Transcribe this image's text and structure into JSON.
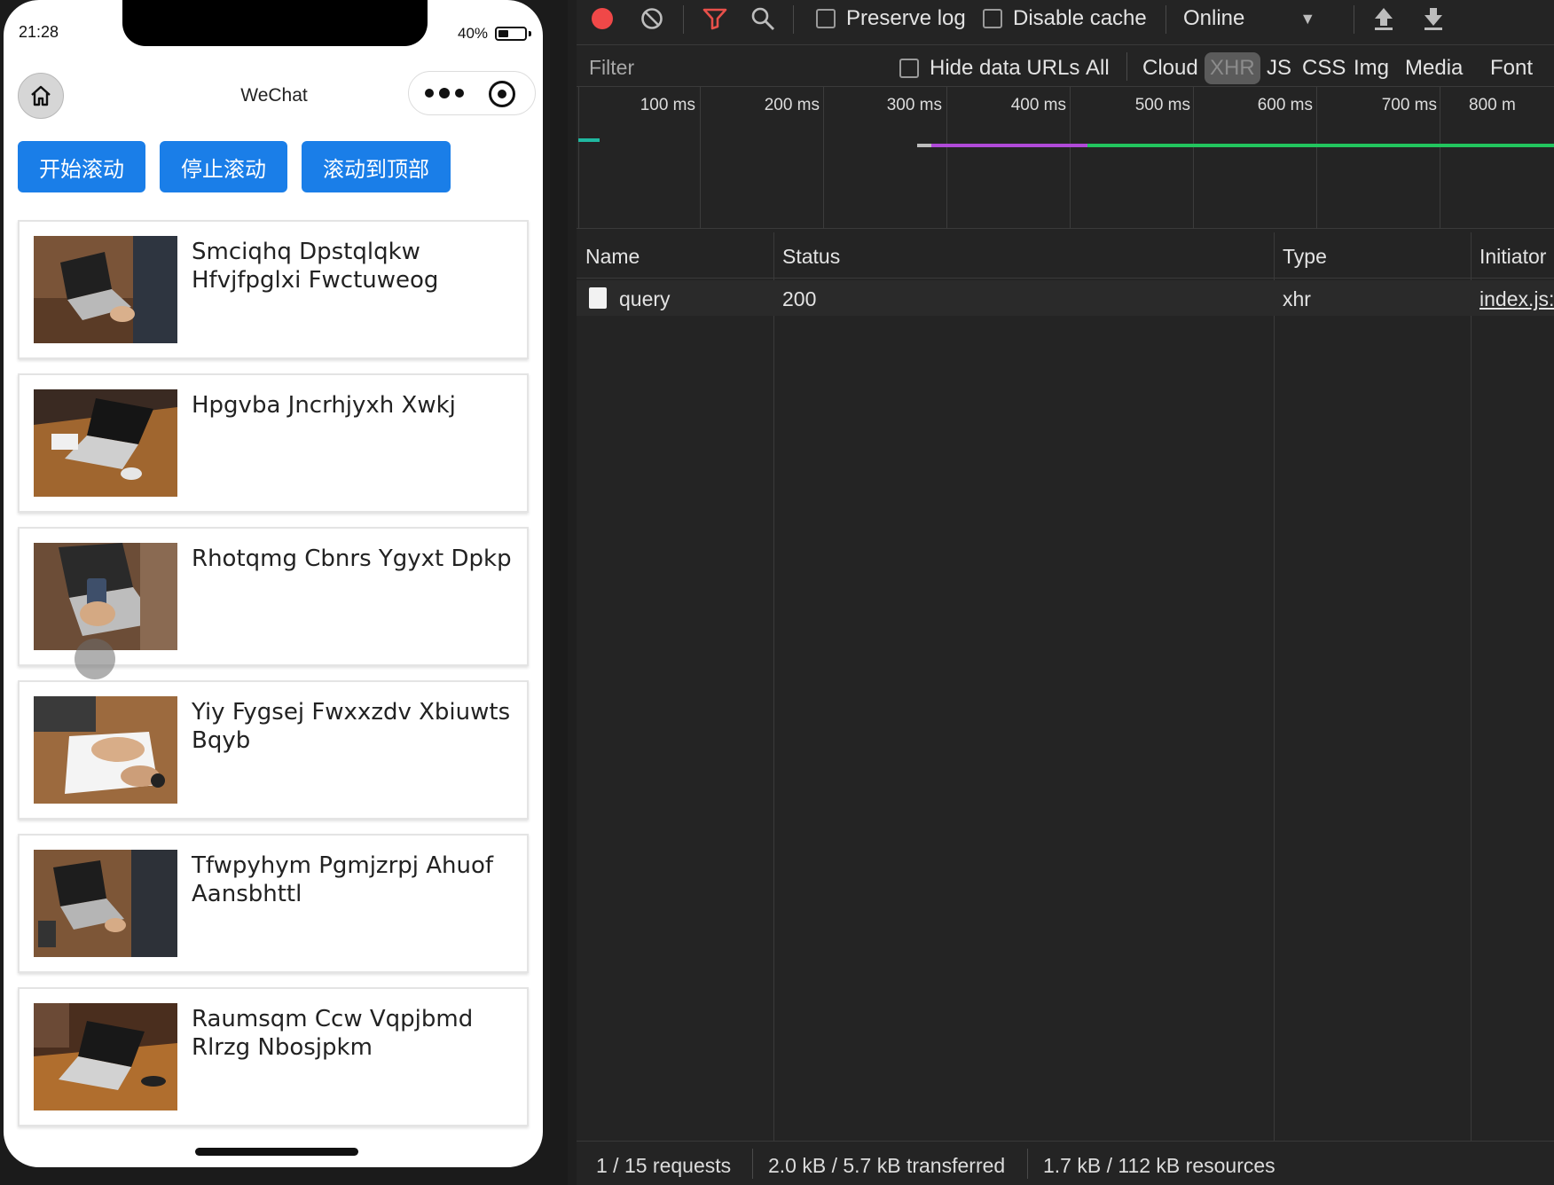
{
  "phone": {
    "status_time": "21:28",
    "battery_percent": "40%",
    "battery_level": 0.4,
    "nav_title": "WeChat",
    "buttons": [
      "开始滚动",
      "停止滚动",
      "滚动到顶部"
    ],
    "cards": [
      {
        "title": "Smciqhq Dpstqlqkw Hfvjfpglxi Fwctuweog",
        "image": "laptop-typing-photo"
      },
      {
        "title": "Hpgvba Jncrhjyxh Xwkj",
        "image": "laptop-on-desk-photo"
      },
      {
        "title": "Rhotqmg Cbnrs Ygyxt Dpkp",
        "image": "phone-and-laptop-photo"
      },
      {
        "title": "Yiy Fygsej Fwxxzdv Xbiuwts Bqyb",
        "image": "writing-notebook-photo"
      },
      {
        "title": "Tfwpyhym Pgmjzrpj Ahuof Aansbhttl",
        "image": "laptop-typing-photo"
      },
      {
        "title": "Raumsqm Ccw Vqpjbmd Rlrzg Nbosjpkm",
        "image": "laptop-on-desk-photo"
      }
    ]
  },
  "devtools": {
    "toolbar": {
      "preserve_log": "Preserve log",
      "disable_cache": "Disable cache",
      "throttle": "Online"
    },
    "filter": {
      "placeholder": "Filter",
      "hide_data_urls": "Hide data URLs",
      "types": [
        "All",
        "Cloud",
        "XHR",
        "JS",
        "CSS",
        "Img",
        "Media",
        "Font"
      ],
      "active_type": "XHR"
    },
    "timeline": {
      "labels": [
        "100 ms",
        "200 ms",
        "300 ms",
        "400 ms",
        "500 ms",
        "600 ms",
        "700 ms",
        "800 m"
      ]
    },
    "table": {
      "columns": [
        "Name",
        "Status",
        "Type",
        "Initiator"
      ],
      "rows": [
        {
          "name": "query",
          "status": "200",
          "type": "xhr",
          "initiator": "index.js:"
        }
      ]
    },
    "footer": {
      "requests": "1 / 15 requests",
      "transferred": "2.0 kB / 5.7 kB transferred",
      "resources": "1.7 kB / 112 kB resources"
    },
    "colors": {
      "record": "#f04848",
      "filter_icon": "#e8504a",
      "bar_purple": "#b04ad8",
      "bar_green": "#22c55e",
      "bar_teal": "#20b8a0"
    }
  }
}
